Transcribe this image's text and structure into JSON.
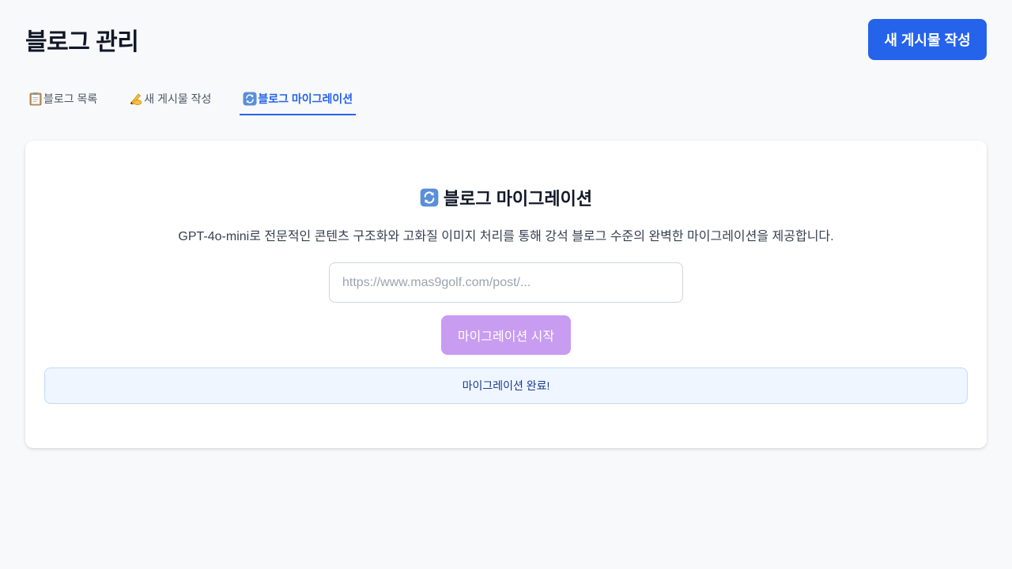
{
  "header": {
    "title": "블로그 관리",
    "new_post_button": "새 게시물 작성"
  },
  "tabs": [
    {
      "icon": "clipboard-icon",
      "label": "블로그 목록",
      "active": false
    },
    {
      "icon": "writing-hand-icon",
      "label": "새 게시물 작성",
      "active": false
    },
    {
      "icon": "refresh-icon",
      "label": "블로그 마이그레이션",
      "active": true
    }
  ],
  "migration": {
    "title": "블로그 마이그레이션",
    "title_icon": "refresh-icon",
    "description": "GPT-4o-mini로 전문적인 콘텐츠 구조화와 고화질 이미지 처리를 통해 강석 블로그 수준의 완벽한 마이그레이션을 제공합니다.",
    "url_input": {
      "value": "",
      "placeholder": "https://www.mas9golf.com/post/..."
    },
    "start_button": "마이그레이션 시작",
    "status_message": "마이그레이션 완료!"
  },
  "colors": {
    "primary": "#2563eb",
    "start_button_disabled": "#c89cf0",
    "status_bg": "#eff6ff",
    "status_border": "#bfdbfe",
    "status_text": "#1e3a8a",
    "page_bg": "#f8f9fb"
  }
}
